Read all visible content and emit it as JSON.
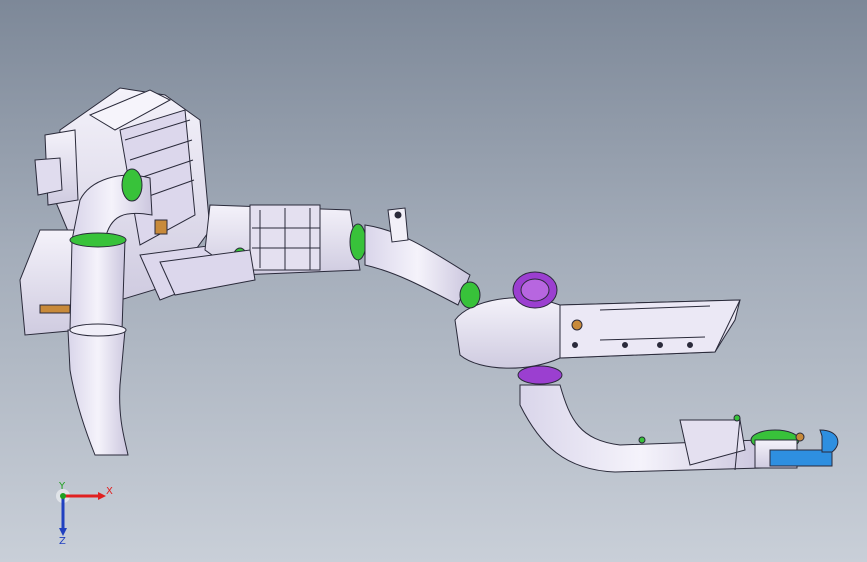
{
  "viewport": {
    "background_top": "#7d8898",
    "background_bottom": "#c9cfd8"
  },
  "model": {
    "part_color": "#e8e4f2",
    "edge_color": "#2a2a3a",
    "clamp_color": "#38c23a",
    "bellows_color": "#9b3fd0",
    "sensor_color": "#2e8fe0",
    "bracket_color": "#c88a3a"
  },
  "triad": {
    "x_label": "X",
    "y_label": "Y",
    "z_label": "Z",
    "x_color": "#e02020",
    "y_color": "#20a020",
    "z_color": "#2040c0"
  }
}
